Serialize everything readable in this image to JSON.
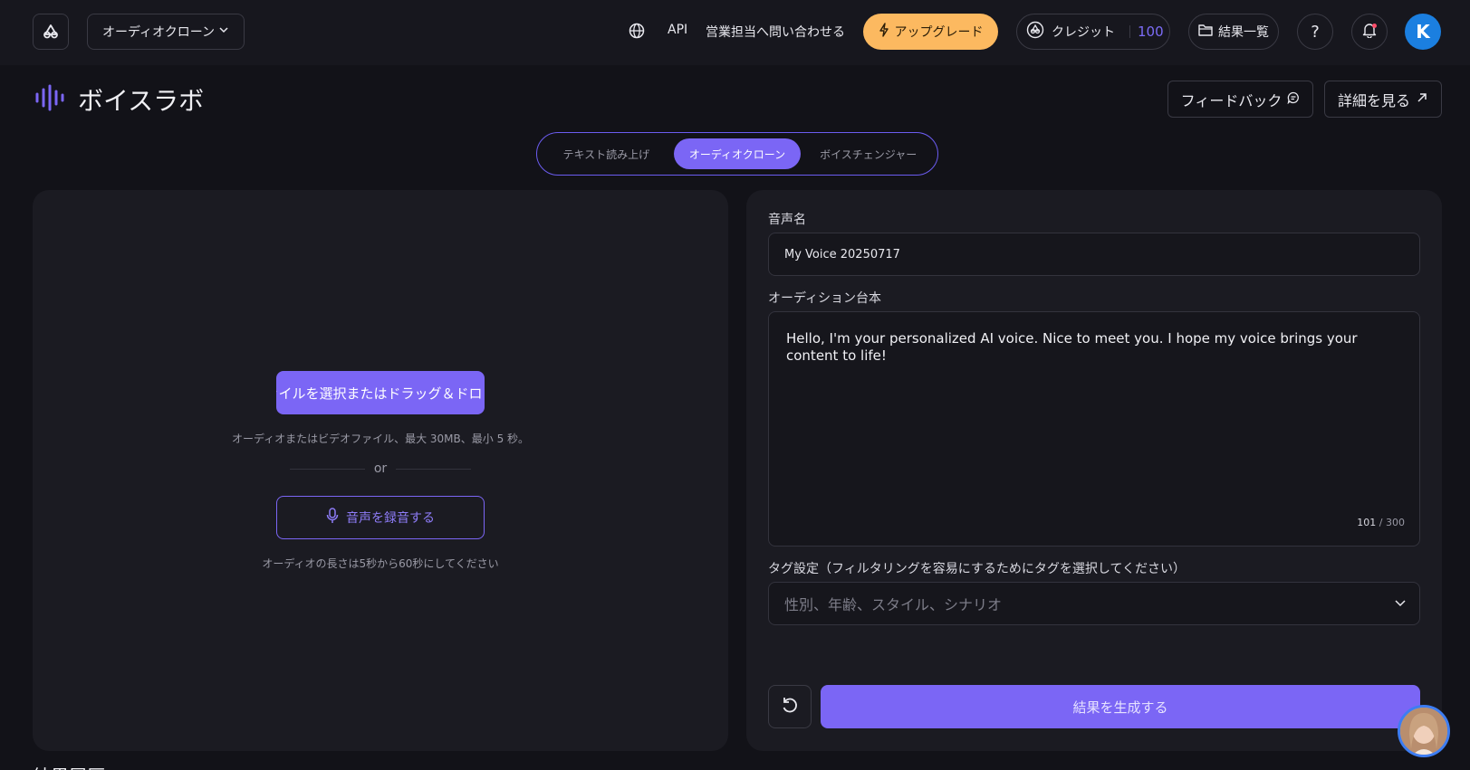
{
  "header": {
    "product_selector": "オーディオクローン",
    "nav_api": "API",
    "nav_contact_sales": "営業担当へ問い合わせる",
    "upgrade_label": "アップグレード",
    "credits_label": "クレジット",
    "credits_count": "100",
    "results_label": "結果一覧",
    "help_glyph": "?",
    "avatar_initial": "K"
  },
  "page": {
    "title": "ボイスラボ",
    "feedback_label": "フィードバック",
    "details_label": "詳細を見る"
  },
  "tabs": [
    {
      "label": "テキスト読み上げ",
      "active": false
    },
    {
      "label": "オーディオクローン",
      "active": true
    },
    {
      "label": "ボイスチェンジャー",
      "active": false
    }
  ],
  "upload": {
    "button_label": "ファイルを選択またはドラッグ＆ドロップ",
    "hint": "オーディオまたはビデオファイル、最大 30MB、最小 5 秒。",
    "or_text": "or",
    "record_label": "音声を録音する",
    "record_hint": "オーディオの長さは5秒から60秒にしてください"
  },
  "form": {
    "voice_name_label": "音声名",
    "voice_name_value": "My Voice 20250717",
    "script_label": "オーディション台本",
    "script_value": "Hello, I'm your personalized AI voice. Nice to meet you. I hope my voice brings your content to life!",
    "char_count_current": "101",
    "char_count_max": "/ 300",
    "tags_label": "タグ設定（フィルタリングを容易にするためにタグを選択してください）",
    "tags_placeholder": "性別、年齢、スタイル、シナリオ",
    "generate_label": "結果を生成する"
  },
  "history": {
    "label": "結果履歴"
  },
  "colors": {
    "accent": "#7b66f5",
    "upgrade": "#fcb960",
    "avatar": "#1b7fe0",
    "background": "#121218",
    "panel": "#1b1b22"
  }
}
